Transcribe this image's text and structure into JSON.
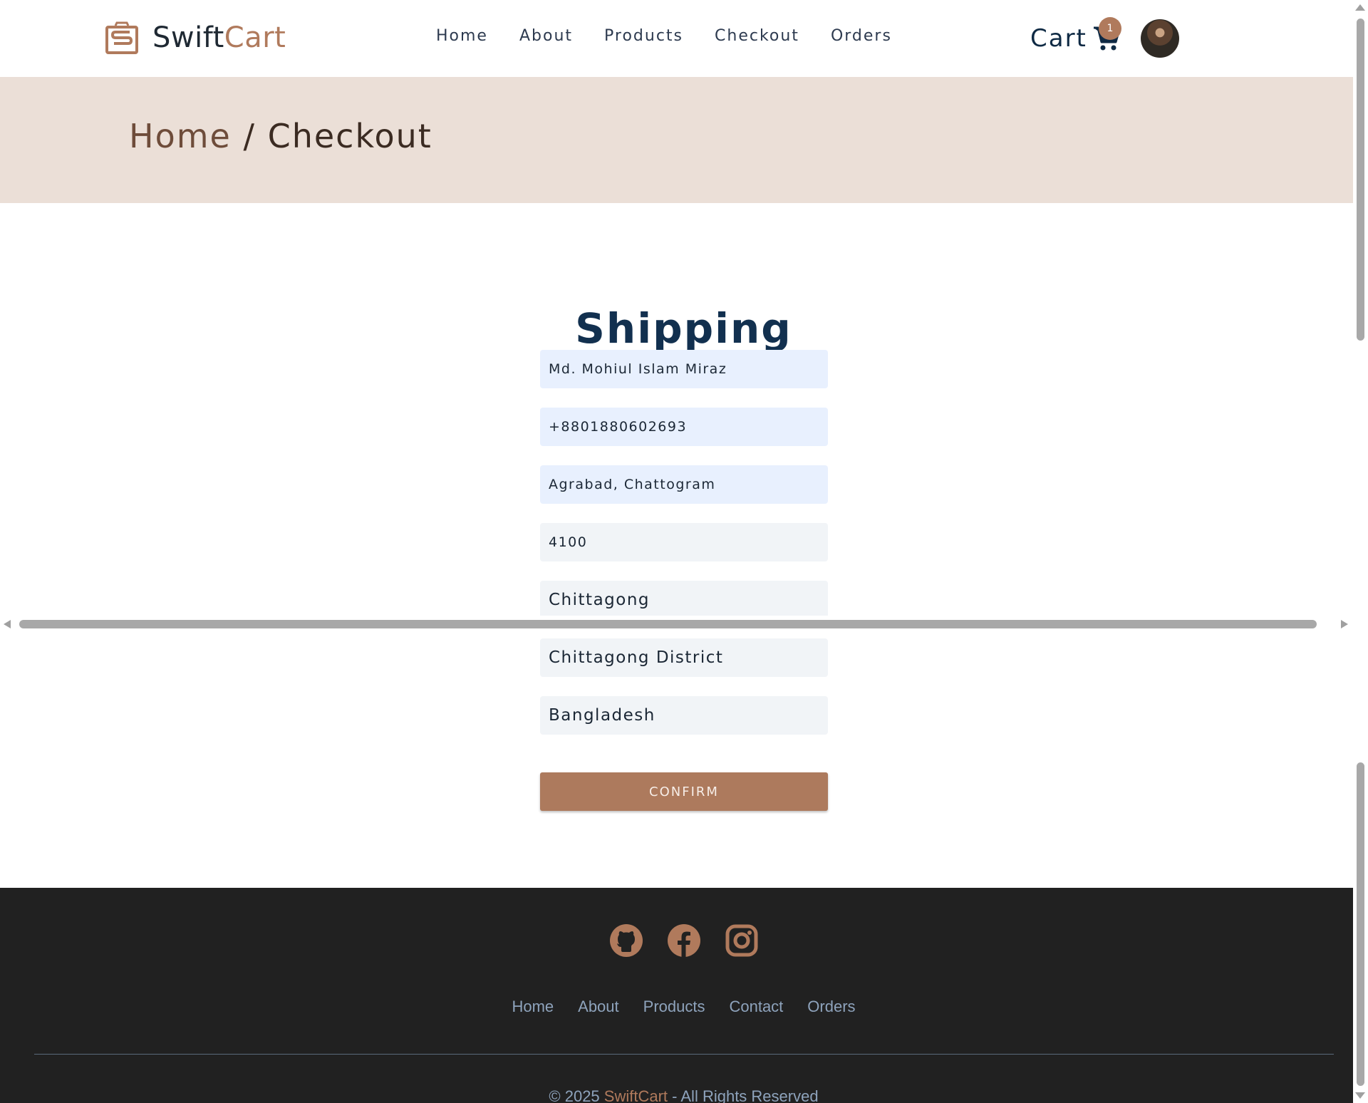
{
  "brand": {
    "name_part1": "Swift",
    "name_part2": "Cart"
  },
  "nav": {
    "links": [
      "Home",
      "About",
      "Products",
      "Checkout",
      "Orders"
    ],
    "cart_label": "Cart",
    "cart_count": "1"
  },
  "breadcrumb": {
    "home": "Home",
    "separator": " / ",
    "current": "Checkout"
  },
  "shipping": {
    "title": "Shipping",
    "fields": {
      "name": "Md. Mohiul Islam Miraz",
      "phone": "+8801880602693",
      "address": "Agrabad, Chattogram",
      "postal_code": "4100",
      "city": "Chittagong",
      "district": "Chittagong District",
      "country": "Bangladesh"
    },
    "confirm_label": "CONFIRM"
  },
  "footer": {
    "social_icons": [
      "github-icon",
      "facebook-icon",
      "instagram-icon"
    ],
    "links": [
      "Home",
      "About",
      "Products",
      "Contact",
      "Orders"
    ],
    "copyright_prefix": "© 2025 ",
    "copyright_brand": "SwiftCart",
    "copyright_suffix": " - All Rights Reserved"
  },
  "colors": {
    "accent": "#b07a5c",
    "banner_bg": "#ebdfd7",
    "footer_bg": "#212121",
    "heading": "#12304f"
  }
}
